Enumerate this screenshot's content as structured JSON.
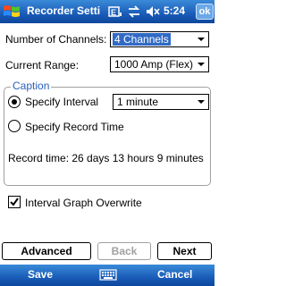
{
  "titlebar": {
    "title": "Recorder Setti",
    "time": "5:24",
    "ok_label": "ok",
    "icons": [
      "windows-start-icon",
      "signal-icon",
      "sync-icon",
      "speaker-muted-icon"
    ]
  },
  "form": {
    "channels_label": "Number of Channels:",
    "channels_value": "4 Channels",
    "range_label": "Current Range:",
    "range_value": "1000 Amp (Flex)"
  },
  "caption": {
    "title": "Caption",
    "specify_interval_label": "Specify Interval",
    "interval_value": "1 minute",
    "specify_record_time_label": "Specify Record Time",
    "record_time_text": "Record time: 26 days 13 hours 9 minutes",
    "selected": "specify_interval"
  },
  "overwrite": {
    "label": "Interval Graph Overwrite",
    "checked": true
  },
  "buttons": {
    "advanced": "Advanced",
    "back": "Back",
    "next": "Next"
  },
  "softkeys": {
    "left": "Save",
    "right": "Cancel"
  },
  "colors": {
    "titlebar": "#1a5cb8",
    "selection": "#316ac5",
    "group_title": "#2a5fbe"
  }
}
